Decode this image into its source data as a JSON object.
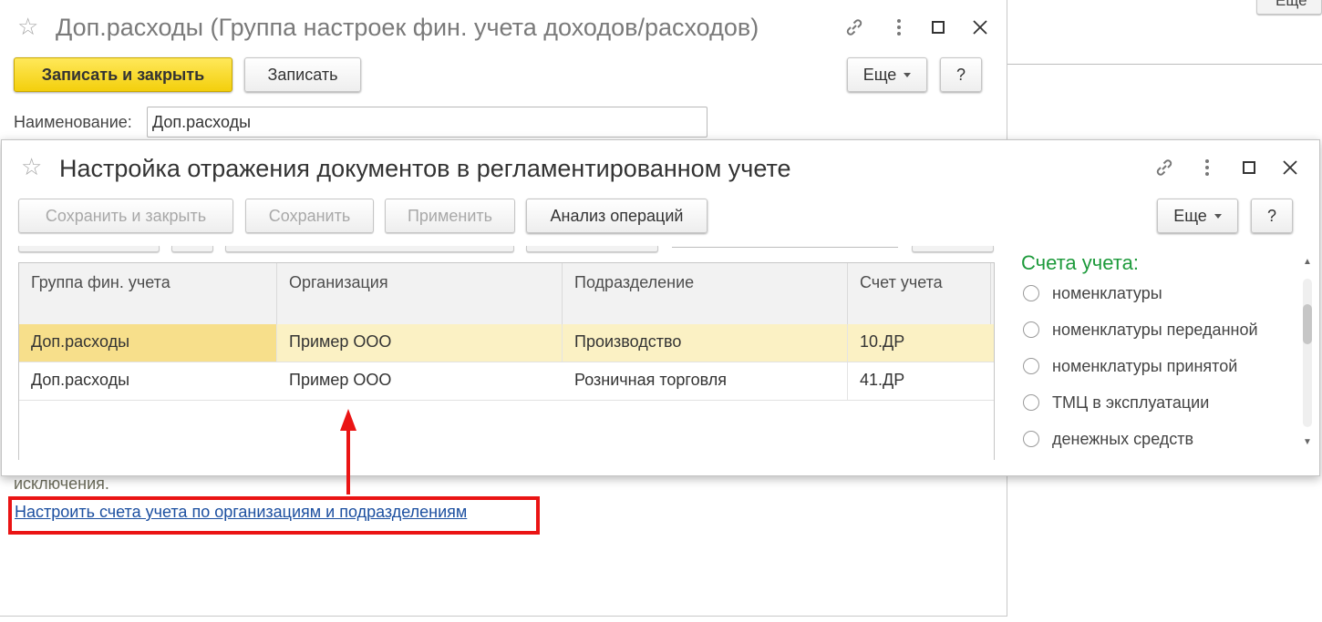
{
  "background": {
    "button_fragment_label": "Еще"
  },
  "parent_window": {
    "title": "Доп.расходы (Группа настроек фин. учета доходов/расходов)",
    "toolbar": {
      "save_close_label": "Записать и закрыть",
      "save_label": "Записать",
      "more_label": "Еще",
      "help_label": "?"
    },
    "name_label": "Наименование:",
    "name_value": "Доп.расходы",
    "exceptions_text": "исключения.",
    "accounts_link": "Настроить счета учета по организациям и подразделениям"
  },
  "child_window": {
    "title": "Настройка отражения документов в регламентированном учете",
    "toolbar": {
      "save_close_label": "Сохранить и закрыть",
      "save_label": "Сохранить",
      "apply_label": "Применить",
      "analysis_label": "Анализ операций",
      "more_label": "Еще",
      "help_label": "?"
    },
    "table": {
      "columns": [
        "Группа фин. учета",
        "Организация",
        "Подразделение",
        "Счет учета"
      ],
      "rows": [
        [
          "Доп.расходы",
          "Пример ООО",
          "Производство",
          "10.ДР"
        ],
        [
          "Доп.расходы",
          "Пример ООО",
          "Розничная торговля",
          "41.ДР"
        ]
      ],
      "selected_row": 0
    },
    "accounts_panel": {
      "title": "Счета учета:",
      "options": [
        "номенклатуры",
        "номенклатуры переданной",
        "номенклатуры принятой",
        "ТМЦ в эксплуатации",
        "денежных средств"
      ]
    }
  },
  "colors": {
    "primary_button": "#f3cf0c",
    "accounts_title": "#1d9a3b",
    "link": "#1c4fa0",
    "annotation": "#ea1414",
    "selected_row": "#fbf1c4"
  },
  "icons": {
    "favorite": "star-icon",
    "link": "link-icon",
    "menu": "more-vertical-icon",
    "maximize": "maximize-icon",
    "close": "close-icon"
  }
}
